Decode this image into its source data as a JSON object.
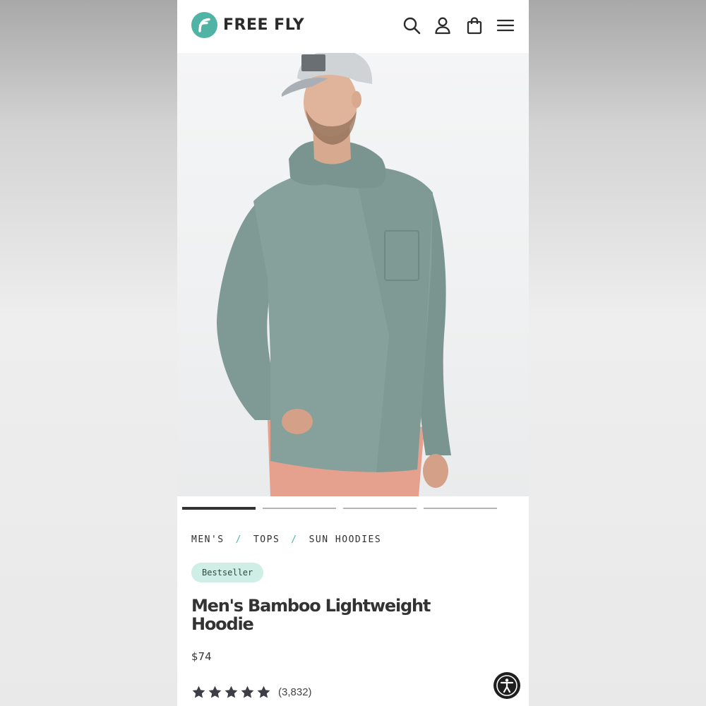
{
  "header": {
    "brand": "FREE FLY",
    "icons": {
      "search": "search-icon",
      "account": "account-icon",
      "cart": "shopping-bag-icon",
      "menu": "hamburger-menu-icon"
    }
  },
  "gallery": {
    "image_alt": "Man wearing a sage green bamboo lightweight hoodie, grey cap and pink shorts",
    "page_count": 4,
    "active_index": 0
  },
  "breadcrumb": {
    "items": [
      "MEN'S",
      "TOPS",
      "SUN HOODIES"
    ],
    "separator": "/"
  },
  "product": {
    "badge": "Bestseller",
    "title": "Men's Bamboo Lightweight Hoodie",
    "price": "$74",
    "rating": {
      "stars": 5,
      "max": 5,
      "count_label": "(3,832)"
    }
  },
  "colors": {
    "brand_teal": "#4fb4a6",
    "badge_bg": "#cfeee5",
    "text_dark": "#333333",
    "star": "#3d3d48"
  }
}
